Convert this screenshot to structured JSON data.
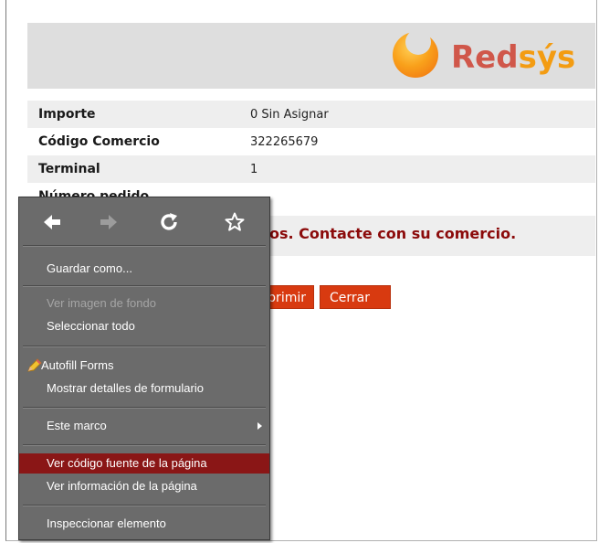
{
  "brand": {
    "logo_red": "Red",
    "logo_sys": "sýs"
  },
  "info": [
    {
      "label": "Importe",
      "value": "0  Sin Asignar"
    },
    {
      "label": "Código Comercio",
      "value": "322265679"
    },
    {
      "label": "Terminal",
      "value": "1"
    },
    {
      "label": "Número pedido",
      "value": ""
    }
  ],
  "error_message": "os. Contacte con su comercio.",
  "buttons": {
    "print": "primir",
    "close": "Cerrar"
  },
  "context_menu": {
    "nav": [
      "back-arrow-icon",
      "forward-arrow-icon",
      "reload-icon",
      "bookmark-star-icon"
    ],
    "items": [
      {
        "label": "Guardar como...",
        "disabled": false
      },
      {
        "label": "Ver imagen de fondo",
        "disabled": true
      },
      {
        "label": "Seleccionar todo",
        "disabled": false
      },
      {
        "label": "Autofill Forms",
        "disabled": false,
        "icon": "pencil-icon"
      },
      {
        "label": "Mostrar detalles de formulario",
        "disabled": false
      },
      {
        "label": "Este marco",
        "disabled": false,
        "submenu": true
      },
      {
        "label": "Ver código fuente de la página",
        "disabled": false,
        "highlighted": true
      },
      {
        "label": "Ver información de la página",
        "disabled": false
      },
      {
        "label": "Inspeccionar elemento",
        "disabled": false
      }
    ]
  },
  "colors": {
    "header_bg": "#dedede",
    "error_text": "#8b0a0a",
    "button_bg": "#d83a10",
    "menu_bg": "#6b6b6b",
    "menu_highlight": "#8a1616"
  }
}
